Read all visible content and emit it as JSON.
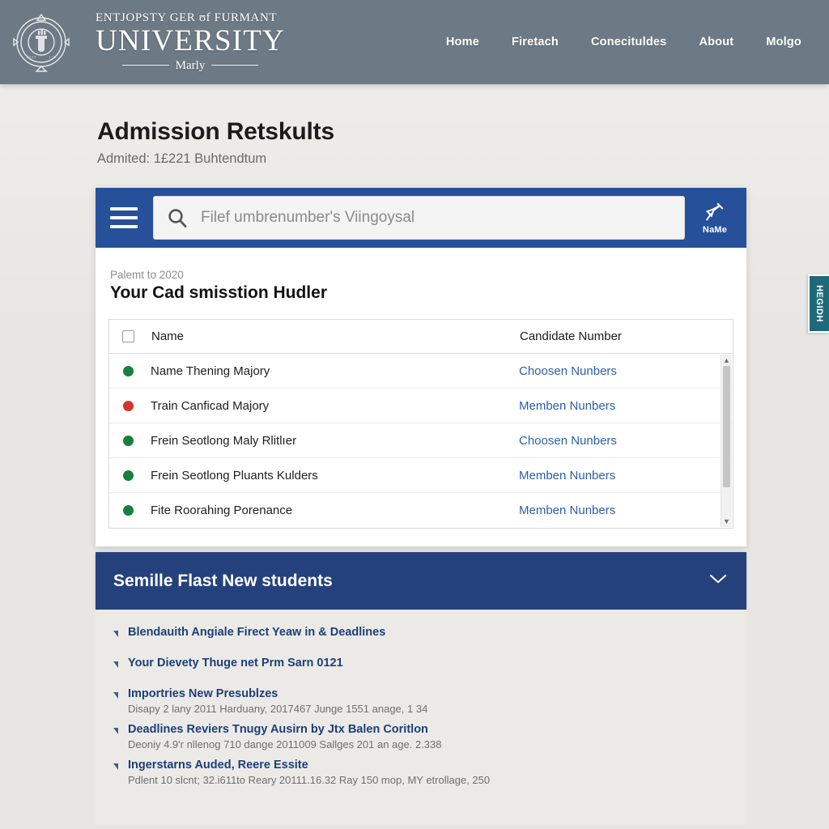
{
  "header": {
    "crest_alt": "university-crest",
    "brand_top": "ENTJOPSTY GER ʊf FURMANT",
    "brand_main": "UNIVERSITY",
    "brand_sub": "Marly",
    "nav": [
      {
        "label": "Home"
      },
      {
        "label": "Firetach"
      },
      {
        "label": "Conecituldes"
      },
      {
        "label": "About"
      },
      {
        "label": "Molgo"
      }
    ],
    "bg_color": "#6d7a85"
  },
  "page": {
    "title": "Admission Retskults",
    "subtitle": "Admited: 1£221 Buhtendtum"
  },
  "search": {
    "placeholder": "Filef umbrenumber's Viingoysal",
    "value": "",
    "pin_label": "NaMe",
    "bar_color": "#27509b"
  },
  "content": {
    "eyebrow": "Palemt to 2020",
    "section_title": "Your Cad smisstion Hudler"
  },
  "table": {
    "columns": [
      "Name",
      "Candidate Number"
    ],
    "rows": [
      {
        "status": "green",
        "status_color": "#17803d",
        "name": "Name Thening Majory",
        "candidate": "Choosen Nunbers"
      },
      {
        "status": "red",
        "status_color": "#d3372b",
        "name": "Train Canficad Majory",
        "candidate": "Memben Nunbers"
      },
      {
        "status": "green",
        "status_color": "#17803d",
        "name": "Frein Seotlong Maly Rlitlıer",
        "candidate": "Choosen Nunbers"
      },
      {
        "status": "green",
        "status_color": "#17803d",
        "name": "Frein Seotlong Pluants Kulders",
        "candidate": "Memben Nunbers"
      },
      {
        "status": "green",
        "status_color": "#17803d",
        "name": "Fite Roorahing Porenance",
        "candidate": "Memben Nunbers"
      }
    ]
  },
  "accordion": {
    "title": "Semille Flast New students",
    "bg_color": "#24417c",
    "expanded": true
  },
  "links": [
    {
      "title": "Blendauith Angiale Firect Yeaw in & Deadlines",
      "desc": ""
    },
    {
      "title": "Your Dievety Thuge net Prm Sarn 0121",
      "desc": ""
    },
    {
      "title": "Importries New Presublzes",
      "desc": "Disapy 2 lany 2011 Harduany, 2017467 Junge 1551 anage, 1 34"
    },
    {
      "title": "Deadlines Reviers Tnugy Ausirn by Jtx Balen Coritlon",
      "desc": "Deoniy 4.9'r nllenog 710 dange 2011009 Sallges 201 an age. 2.338"
    },
    {
      "title": "Ingerstarns Auded, Reere Essite",
      "desc": "Pdlent 10 slcnt; 32.i611to Reary 20111.16.32 Ray 150 mop, MY etrollage, 250"
    }
  ],
  "feedback_tab": {
    "label": "HEGIDH",
    "color": "#1f6a7a"
  }
}
